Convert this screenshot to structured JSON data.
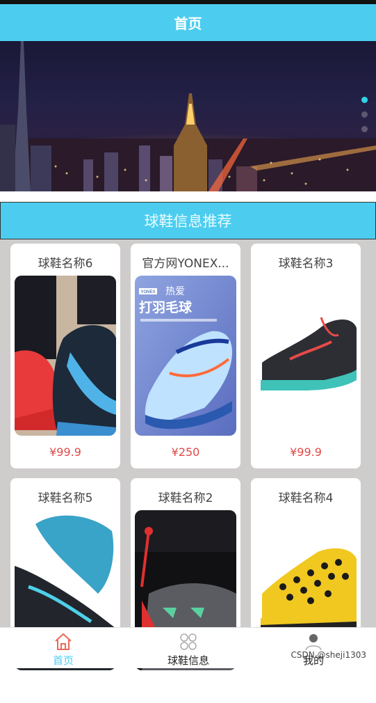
{
  "header": {
    "title": "首页"
  },
  "banner": {
    "dots": 3,
    "active_index": 0,
    "image": "city-night-skyline"
  },
  "section": {
    "title": "球鞋信息推荐"
  },
  "products": [
    {
      "name": "球鞋名称6",
      "price": "¥99.9",
      "image": "red-black-sneakers"
    },
    {
      "name": "官方网YONEX...",
      "price": "¥250",
      "image": "yonex-badminton-shoe",
      "image_text": "打羽毛球",
      "image_brand": "YONEX",
      "image_tag": "热爱"
    },
    {
      "name": "球鞋名称3",
      "price": "¥99.9",
      "image": "teal-black-sneaker"
    },
    {
      "name": "球鞋名称5",
      "price": "",
      "image": "blue-sole-sneaker"
    },
    {
      "name": "球鞋名称2",
      "price": "",
      "image": "jordan-box-sneaker"
    },
    {
      "name": "球鞋名称4",
      "price": "",
      "image": "yellow-black-sneaker"
    }
  ],
  "tabbar": {
    "items": [
      {
        "label": "首页",
        "icon": "home-icon",
        "active": true
      },
      {
        "label": "球鞋信息",
        "icon": "grid-icon",
        "active": false
      },
      {
        "label": "我的",
        "icon": "user-icon",
        "active": false
      }
    ]
  },
  "watermark": "CSDN @sheji1303",
  "colors": {
    "primary": "#4ccdf0",
    "price": "#e04848",
    "active_tab": "#4ccdf0",
    "active_icon": "#e86a5a"
  }
}
